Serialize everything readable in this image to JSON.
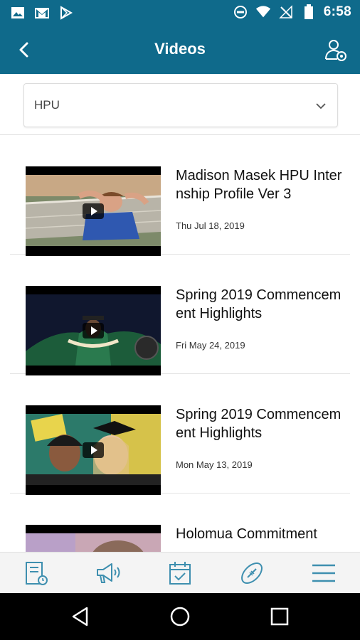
{
  "status_bar": {
    "time": "6:58",
    "left_icons": [
      "image-icon",
      "gmail-icon",
      "play-store-icon"
    ],
    "right_icons": [
      "do-not-disturb-icon",
      "wifi-icon",
      "no-signal-icon",
      "battery-icon"
    ]
  },
  "app_bar": {
    "title": "Videos",
    "back_icon": "back-arrow-icon",
    "profile_icon": "user-settings-icon"
  },
  "filter": {
    "selected": "HPU"
  },
  "videos": [
    {
      "title": "Madison Masek HPU Internship Profile Ver 3",
      "date": "Thu Jul 18, 2019"
    },
    {
      "title": "Spring 2019 Commencement Highlights",
      "date": "Fri May 24, 2019"
    },
    {
      "title": "Spring 2019 Commencement Highlights",
      "date": "Mon May 13, 2019"
    },
    {
      "title": "Holomua Commitment",
      "date": ""
    }
  ],
  "tabs": [
    {
      "name": "news-icon"
    },
    {
      "name": "megaphone-icon"
    },
    {
      "name": "calendar-icon"
    },
    {
      "name": "football-icon"
    },
    {
      "name": "menu-icon"
    }
  ],
  "colors": {
    "header": "#0f6a8b",
    "tab_icon": "#3e8faf"
  }
}
